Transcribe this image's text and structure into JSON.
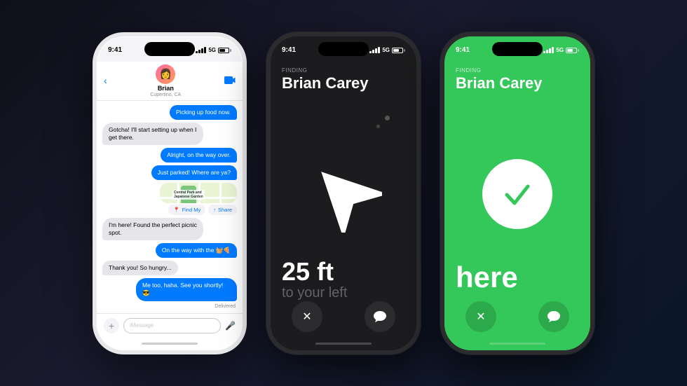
{
  "phones": {
    "imessage": {
      "status_time": "9:41",
      "signal": "5G",
      "contact_name": "Brian",
      "contact_sub": "Cupertino, CA",
      "contact_emoji": "👩",
      "messages": [
        {
          "id": 1,
          "type": "sent",
          "text": "Picking up food now."
        },
        {
          "id": 2,
          "type": "received",
          "text": "Gotcha! I'll start setting up when I get there."
        },
        {
          "id": 3,
          "type": "sent",
          "text": "Alright, on the way over."
        },
        {
          "id": 4,
          "type": "sent",
          "text": "Just parked! Where are ya?"
        },
        {
          "id": 5,
          "type": "map"
        },
        {
          "id": 6,
          "type": "received",
          "text": "I'm here! Found the perfect picnic spot."
        },
        {
          "id": 7,
          "type": "sent",
          "text": "On the way with the 🧺🍕"
        },
        {
          "id": 8,
          "type": "received",
          "text": "Thank you! So hungry..."
        },
        {
          "id": 9,
          "type": "sent",
          "text": "Me too, haha. See you shortly! 😎"
        }
      ],
      "delivered": "Delivered",
      "find_my_btn": "Find My",
      "share_btn": "Share",
      "input_placeholder": "iMessage"
    },
    "finding_dark": {
      "status_time": "9:41",
      "signal": "5G",
      "finding_label": "FINDING",
      "person_name": "Brian Carey",
      "distance": "25 ft",
      "direction": "to your left",
      "close_icon": "✕",
      "message_icon": "💬"
    },
    "finding_green": {
      "status_time": "9:41",
      "signal": "5G",
      "finding_label": "FINDING",
      "person_name": "Brian Carey",
      "here_text": "here",
      "close_icon": "✕",
      "message_icon": "💬"
    }
  }
}
